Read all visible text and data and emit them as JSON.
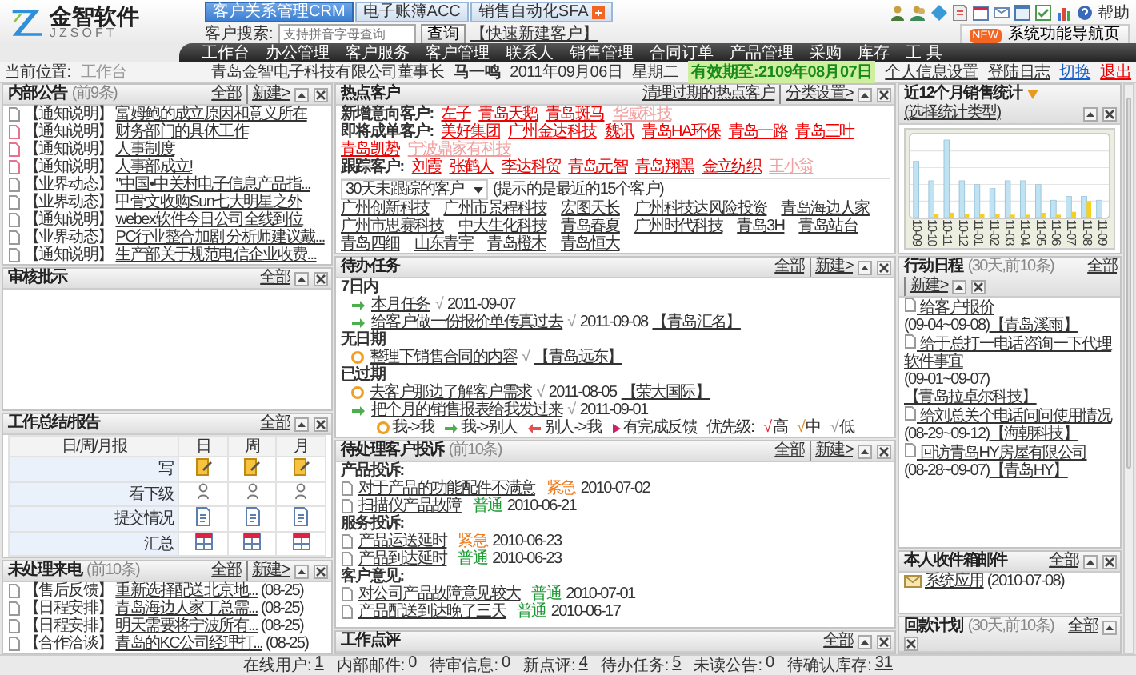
{
  "header": {
    "logo": {
      "name": "金智软件",
      "subtitle": "JZSOFT"
    },
    "modules": [
      {
        "label": "客户关系管理CRM",
        "selected": true
      },
      {
        "label": "电子账簿ACC",
        "selected": false
      },
      {
        "label": "销售自动化SFA",
        "selected": false
      }
    ],
    "search": {
      "label": "客户搜索:",
      "placeholder": "支持拼音字母查询",
      "button": "查询",
      "quick_link": "【快速新建客户】"
    },
    "help": "帮助",
    "nav_badge": "NEW",
    "nav_button": "系统功能导航页"
  },
  "menu": [
    "工作台",
    "办公管理",
    "客户服务",
    "客户管理",
    "联系人",
    "销售管理",
    "合同订单",
    "产品管理",
    "采购",
    "库存",
    "工 具"
  ],
  "breadcrumb": {
    "label": "当前位置:",
    "current": "工作台",
    "company": "青岛金智电子科技有限公司董事长",
    "user": "马一鸣",
    "date": "2011年09月06日",
    "weekday": "星期二",
    "validity": "有效期至:2109年08月07日",
    "links": [
      "个人信息设置",
      "登陆日志",
      "切换"
    ],
    "logout": "退出"
  },
  "notices": {
    "title": "内部公告",
    "count": "(前9条)",
    "actions": [
      "全部",
      "新建>"
    ],
    "items": [
      {
        "tag": "【通知说明】",
        "title": "富姆鲍的成立原因和意义所在",
        "unread": false
      },
      {
        "tag": "【通知说明】",
        "title": "财务部门的具体工作",
        "unread": true
      },
      {
        "tag": "【通知说明】",
        "title": "人事制度",
        "unread": true
      },
      {
        "tag": "【通知说明】",
        "title": "人事部成立!",
        "unread": true
      },
      {
        "tag": "【业界动态】",
        "title": "\"中国•中关村电子信息产品指...",
        "unread": false
      },
      {
        "tag": "【业界动态】",
        "title": "甲骨文收购Sun七大明星之外",
        "unread": false
      },
      {
        "tag": "【通知说明】",
        "title": "webex软件今日公司全线到位",
        "unread": false
      },
      {
        "tag": "【业界动态】",
        "title": "PC行业整合加剧 分析师建议戴...",
        "unread": false
      },
      {
        "tag": "【通知说明】",
        "title": "生产部关于规范电信企业收费...",
        "unread": false
      }
    ]
  },
  "approvals": {
    "title": "审核批示",
    "actions": [
      "全部"
    ]
  },
  "work_reports": {
    "title": "工作总结/报告",
    "actions": [
      "全部"
    ],
    "columns": [
      "日/周/月报",
      "日",
      "周",
      "月"
    ],
    "rows": [
      {
        "label": "写",
        "kind": "write"
      },
      {
        "label": "看下级",
        "kind": "view"
      },
      {
        "label": "提交情况",
        "kind": "submit"
      },
      {
        "label": "汇总",
        "kind": "summary"
      }
    ]
  },
  "calls": {
    "title": "未处理来电",
    "count": "(前10条)",
    "actions": [
      "全部",
      "新建>"
    ],
    "items": [
      {
        "tag": "【售后反馈】",
        "title": "重新选择配送北京地...",
        "date": "(08-25)"
      },
      {
        "tag": "【日程安排】",
        "title": "青岛海边人家丁总需...",
        "date": "(08-25)"
      },
      {
        "tag": "【日程安排】",
        "title": "明天需要将宁波所有...",
        "date": "(08-25)"
      },
      {
        "tag": "【合作洽谈】",
        "title": "青岛的KC公司经理打...",
        "date": "(08-25)"
      }
    ]
  },
  "hot_customers": {
    "title": "热点客户",
    "actions": [
      "清理过期的热点客户",
      "分类设置>"
    ],
    "groups": [
      {
        "label": "新增意向客户:",
        "customers": [
          {
            "name": "左子",
            "muted": false
          },
          {
            "name": "青岛天鹅",
            "muted": false
          },
          {
            "name": "青岛斑马",
            "muted": false
          },
          {
            "name": "华威科技",
            "muted": true
          }
        ]
      },
      {
        "label": "即将成单客户:",
        "customers": [
          {
            "name": "美好集团",
            "muted": false
          },
          {
            "name": "广州金达科技",
            "muted": false
          },
          {
            "name": "魏讯",
            "muted": false
          },
          {
            "name": "青岛HA环保",
            "muted": false
          },
          {
            "name": "青岛一路",
            "muted": false
          },
          {
            "name": "青岛三叶",
            "muted": false
          },
          {
            "name": "青岛凯势",
            "muted": false
          },
          {
            "name": "宁波鼎家有科技",
            "muted": true
          }
        ]
      },
      {
        "label": "跟踪客户:",
        "customers": [
          {
            "name": "刘霞",
            "muted": false
          },
          {
            "name": "张鹤人",
            "muted": false
          },
          {
            "name": "李达科贸",
            "muted": false
          },
          {
            "name": "青岛元智",
            "muted": false
          },
          {
            "name": "青岛翔黑",
            "muted": false
          },
          {
            "name": "金立纺织",
            "muted": false
          },
          {
            "name": "王小翁",
            "muted": true
          }
        ]
      }
    ],
    "filter": {
      "value": "30天未跟踪的客户",
      "hint": "(提示的是最近的15个客户)"
    },
    "untracked": [
      "广州创新科技",
      "广州市景程科技",
      "宏图天长",
      "广州科技达风险投资",
      "青岛海边人家",
      "广州市思赛科技",
      "中大生化科技",
      "青岛春夏",
      "广州时代科技",
      "青岛3H",
      "青岛站台",
      "青岛四细",
      "山东青宇",
      "青岛橙木",
      "青岛恒大"
    ]
  },
  "tasks": {
    "title": "待办任务",
    "actions": [
      "全部",
      "新建>"
    ],
    "groups": [
      {
        "label": "7日内",
        "items": [
          {
            "kind": "self-to-other",
            "title": "本月任务",
            "mark": "√",
            "color": "#999999",
            "date": "2011-09-07"
          },
          {
            "kind": "self-to-other",
            "title": "给客户做一份报价单传真过去",
            "mark": "√",
            "color": "#999999",
            "date": "2011-09-08",
            "customer": "【青岛汇名】"
          }
        ]
      },
      {
        "label": "无日期",
        "items": [
          {
            "kind": "self",
            "title": "整理下销售合同的内容",
            "mark": "√",
            "color": "#999999",
            "customer": "【青岛远东】"
          }
        ]
      },
      {
        "label": "已过期",
        "items": [
          {
            "kind": "self",
            "title": "去客户那边了解客户需求",
            "mark": "√",
            "color": "#999999",
            "date": "2011-08-05",
            "customer": "【荣大国际】"
          },
          {
            "kind": "self-to-other",
            "title": "把个月的销售报表给我发过来",
            "mark": "√",
            "color": "#999999",
            "date": "2011-09-01"
          }
        ]
      }
    ],
    "legend": [
      {
        "kind": "self",
        "label": "我->我"
      },
      {
        "kind": "self-to-other",
        "label": "我->别人"
      },
      {
        "kind": "other-to-self",
        "label": "别人->我"
      },
      {
        "kind": "feedback",
        "label": "有完成反馈"
      }
    ],
    "priority_label": "优先级:",
    "priorities": [
      {
        "mark": "√",
        "label": "高",
        "color": "#e03030"
      },
      {
        "mark": "√",
        "label": "中",
        "color": "#e08a20"
      },
      {
        "mark": "√",
        "label": "低",
        "color": "#999999"
      }
    ]
  },
  "complaints": {
    "title": "待处理客户投诉",
    "count": "(前10条)",
    "actions": [
      "全部",
      "新建>"
    ],
    "groups": [
      {
        "label": "产品投诉:",
        "items": [
          {
            "title": "对于产品的功能配件不满意",
            "urgency_label": "紧急",
            "color": "#f07a1a",
            "date": "2010-07-02"
          },
          {
            "title": "扫描仪产品故障",
            "urgency_label": "普通",
            "color": "#1a9a30",
            "date": "2010-06-21"
          }
        ]
      },
      {
        "label": "服务投诉:",
        "items": [
          {
            "title": "产品运送延时",
            "urgency_label": "紧急",
            "color": "#f07a1a",
            "date": "2010-06-23"
          },
          {
            "title": "产品到达延时",
            "urgency_label": "普通",
            "color": "#1a9a30",
            "date": "2010-06-23"
          }
        ]
      },
      {
        "label": "客户意见:",
        "items": [
          {
            "title": "对公司产品故障意见较大",
            "urgency_label": "普通",
            "color": "#1a9a30",
            "date": "2010-07-01"
          },
          {
            "title": "产品配送到达晚了三天",
            "urgency_label": "普通",
            "color": "#1a9a30",
            "date": "2010-06-17"
          }
        ]
      }
    ]
  },
  "reviews": {
    "title": "工作点评",
    "actions": [
      "全部"
    ]
  },
  "sales_stats": {
    "title": "近12个月销售统计",
    "link": "(选择统计类型)",
    "months": [
      "10-09",
      "10-10",
      "10-11",
      "10-12",
      "11-01",
      "11-02",
      "11-03",
      "11-04",
      "11-05",
      "11-06",
      "11-07",
      "11-08",
      "11-09"
    ]
  },
  "schedule": {
    "title": "行动日程",
    "count": "(30天,前10条)",
    "actions": [
      "全部",
      "新建>"
    ],
    "items": [
      {
        "title": "给客户报价",
        "range": "(09-04~09-08)",
        "customer": "【青岛溪雨】"
      },
      {
        "title": "给于总打一电话咨询一下代理软件事宜",
        "range": "(09-01~09-07)",
        "customer": "【青岛拉卓尔科技】"
      },
      {
        "title": "给刘总关个电话问问使用情况",
        "range": "(08-29~09-12)",
        "customer": "【海朝科技】"
      },
      {
        "title": "回访青岛HY房屋有限公司",
        "range": "(08-28~09-07)",
        "customer": "【青岛HY】"
      }
    ]
  },
  "mail": {
    "title": "本人收件箱邮件",
    "actions": [
      "全部"
    ],
    "items": [
      {
        "title": "系统应用",
        "date": "(2010-07-08)"
      }
    ]
  },
  "payments": {
    "title": "回款计划",
    "count": "(30天,前10条)",
    "actions": [
      "全部"
    ]
  },
  "status_bar": [
    {
      "label": "在线用户:",
      "value": "1",
      "link": true
    },
    {
      "label": "内部邮件:",
      "value": "0",
      "link": false
    },
    {
      "label": "待审信息:",
      "value": "0",
      "link": false
    },
    {
      "label": "新点评:",
      "value": "4",
      "link": true
    },
    {
      "label": "待办任务:",
      "value": "5",
      "link": true
    },
    {
      "label": "未读公告:",
      "value": "0",
      "link": false
    },
    {
      "label": "待确认库存:",
      "value": "31",
      "link": true
    }
  ]
}
